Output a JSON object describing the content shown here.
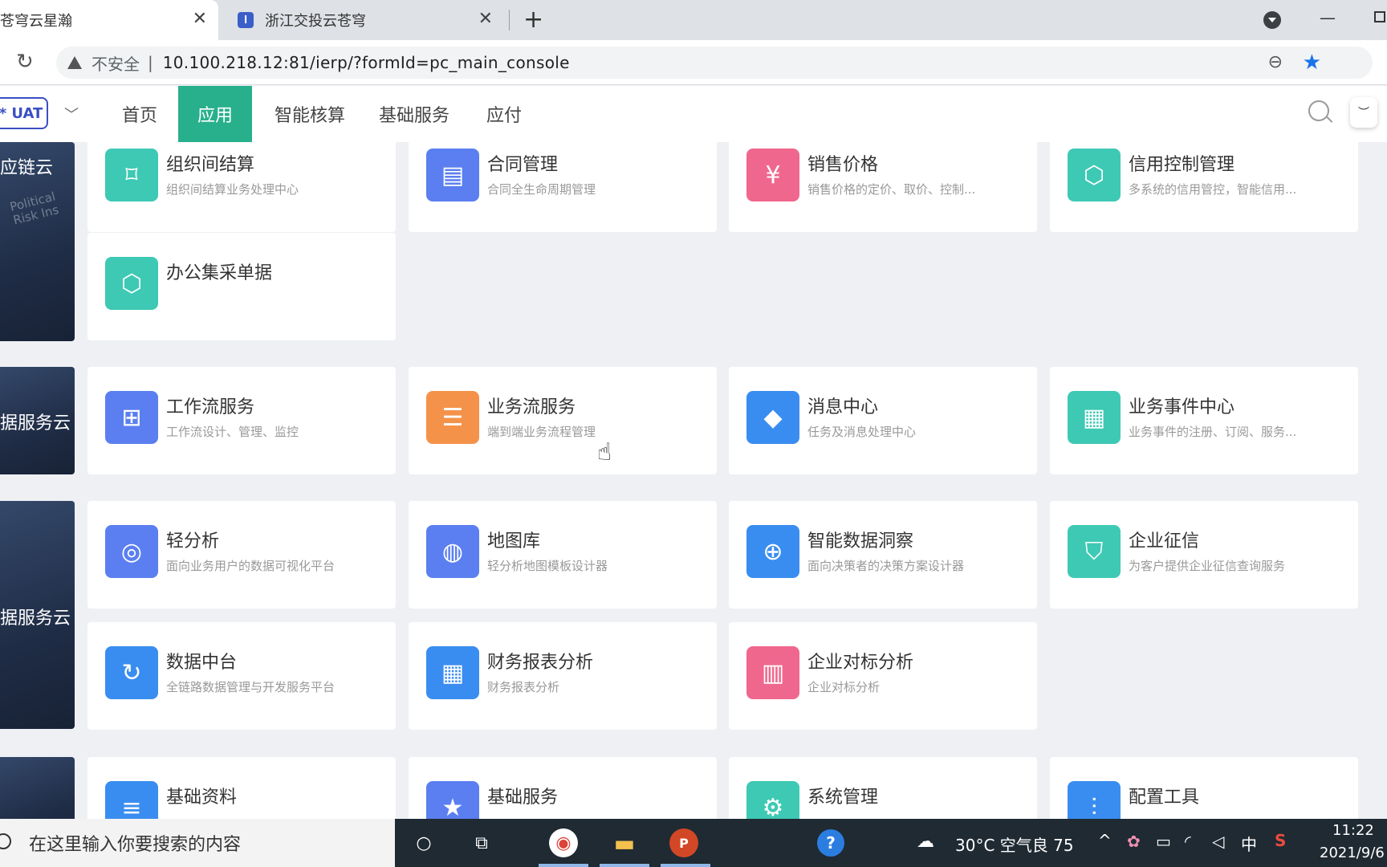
{
  "browser": {
    "tabs": [
      {
        "title": "苍穹云星瀚",
        "close": "✕"
      },
      {
        "title": "浙江交投云苍穹",
        "close": "✕"
      }
    ],
    "new_tab": "+",
    "insecure_label": "不安全",
    "url_separator": "|",
    "url": "10.100.218.12:81/ierp/?formId=pc_main_console"
  },
  "header": {
    "env_badge": "* UAT",
    "nav": [
      "首页",
      "应用",
      "智能核算",
      "基础服务",
      "应付"
    ],
    "active_nav": "应用"
  },
  "groups": [
    {
      "label": "应链云"
    },
    {
      "label": "据服务云"
    },
    {
      "label": "据服务云"
    }
  ],
  "side_deco": "Political\nRisk Ins",
  "cards": [
    {
      "title": "组织间结算",
      "desc": "组织间结算业务处理中心",
      "icon": "tag-icon",
      "color": "#3ec9b4"
    },
    {
      "title": "合同管理",
      "desc": "合同全生命周期管理",
      "icon": "briefcase-icon",
      "color": "#5b7ff0"
    },
    {
      "title": "销售价格",
      "desc": "销售价格的定价、取价、控制...",
      "icon": "price-icon",
      "color": "#f0678e"
    },
    {
      "title": "信用控制管理",
      "desc": "多系统的信用管控，智能信用...",
      "icon": "cube-icon",
      "color": "#3ec9b4"
    },
    {
      "title": "办公集采单据",
      "desc": "",
      "icon": "cube-icon",
      "color": "#3ec9b4"
    },
    {
      "title": "工作流服务",
      "desc": "工作流设计、管理、监控",
      "icon": "workflow-icon",
      "color": "#5b7ff0"
    },
    {
      "title": "业务流服务",
      "desc": "端到端业务流程管理",
      "icon": "document-icon",
      "color": "#f5924a"
    },
    {
      "title": "消息中心",
      "desc": "任务及消息处理中心",
      "icon": "diamond-icon",
      "color": "#3a8df0"
    },
    {
      "title": "业务事件中心",
      "desc": "业务事件的注册、订阅、服务...",
      "icon": "event-icon",
      "color": "#3ec9b4"
    },
    {
      "title": "轻分析",
      "desc": "面向业务用户的数据可视化平台",
      "icon": "analysis-icon",
      "color": "#5b7ff0"
    },
    {
      "title": "地图库",
      "desc": "轻分析地图模板设计器",
      "icon": "globe-icon",
      "color": "#5b7ff0"
    },
    {
      "title": "智能数据洞察",
      "desc": "面向决策者的决策方案设计器",
      "icon": "insight-icon",
      "color": "#3a8df0"
    },
    {
      "title": "企业征信",
      "desc": "为客户提供企业征信查询服务",
      "icon": "shield-icon",
      "color": "#3ec9b4"
    },
    {
      "title": "数据中台",
      "desc": "全链路数据管理与开发服务平台",
      "icon": "data-hub-icon",
      "color": "#3a8df0"
    },
    {
      "title": "财务报表分析",
      "desc": "财务报表分析",
      "icon": "table-icon",
      "color": "#3a8df0"
    },
    {
      "title": "企业对标分析",
      "desc": "企业对标分析",
      "icon": "clipboard-chart-icon",
      "color": "#f0678e"
    },
    {
      "title": "基础资料",
      "desc": "",
      "icon": "server-icon",
      "color": "#3a8df0"
    },
    {
      "title": "基础服务",
      "desc": "",
      "icon": "folder-star-icon",
      "color": "#5b7ff0"
    },
    {
      "title": "系统管理",
      "desc": "",
      "icon": "folder-gear-icon",
      "color": "#3ec9b4"
    },
    {
      "title": "配置工具",
      "desc": "",
      "icon": "sliders-icon",
      "color": "#3a8df0"
    }
  ],
  "taskbar": {
    "search_placeholder": "在这里输入你要搜索的内容",
    "weather": "30°C  空气良 75",
    "ime": "中",
    "time": "11:22",
    "date": "2021/9/6"
  }
}
